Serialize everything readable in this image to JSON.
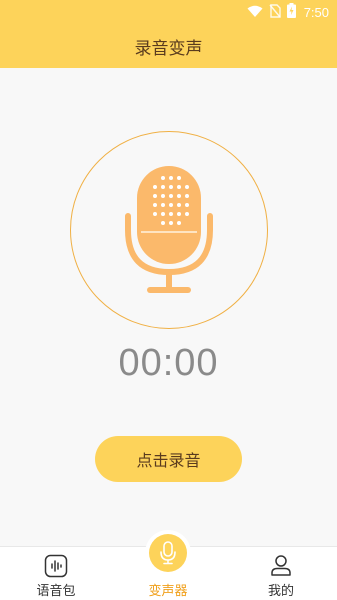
{
  "status_bar": {
    "time": "7:50",
    "icons": [
      "wifi-icon",
      "no-sim-icon",
      "battery-charging-icon"
    ]
  },
  "header": {
    "title": "录音变声"
  },
  "main": {
    "mic_icon": "microphone-icon",
    "timer": "00:00",
    "record_label": "点击录音"
  },
  "bottom_nav": {
    "items": [
      {
        "label": "语音包",
        "icon": "voice-pack-icon",
        "active": false
      },
      {
        "label": "变声器",
        "icon": "microphone-icon",
        "active": true
      },
      {
        "label": "我的",
        "icon": "user-icon",
        "active": false
      }
    ]
  },
  "colors": {
    "accent": "#fdd35a",
    "mic_orange": "#fbb96b",
    "ring": "#f0b044",
    "active_label": "#f0a01c",
    "title_text": "#5a3b1e"
  }
}
